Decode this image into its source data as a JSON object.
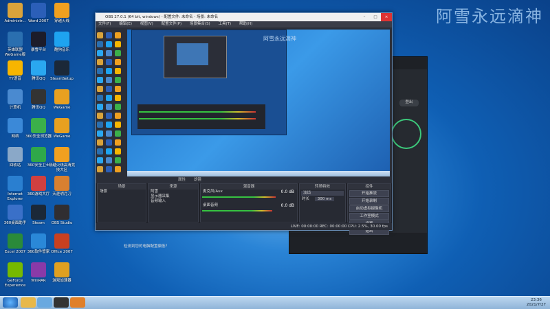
{
  "watermark": "阿雪永远滴神",
  "preview_watermark": "阿雪永远滴神",
  "desktop_icons": [
    {
      "label": "Administr...",
      "color": "#d9a33b"
    },
    {
      "label": "Word 2007",
      "color": "#2b5fb8"
    },
    {
      "label": "穿越火线",
      "color": "#f0a020"
    },
    {
      "label": "英雄联盟 WeGame版",
      "color": "#2a6fb0"
    },
    {
      "label": "暴雪平台",
      "color": "#1c1c2a"
    },
    {
      "label": "酷狗音乐",
      "color": "#1ea3f0"
    },
    {
      "label": "YY语音",
      "color": "#f7b500"
    },
    {
      "label": "腾讯QQ",
      "color": "#2aa7f0"
    },
    {
      "label": "SteamSetup",
      "color": "#1b2838"
    },
    {
      "label": "计算机",
      "color": "#4a8ad0"
    },
    {
      "label": "腾讯QQ",
      "color": "#333"
    },
    {
      "label": "WeGame",
      "color": "#e8a020"
    },
    {
      "label": "网络",
      "color": "#3b89d8"
    },
    {
      "label": "360安全浏览器",
      "color": "#3bb04a"
    },
    {
      "label": "WeGame",
      "color": "#e8a020"
    },
    {
      "label": "回收站",
      "color": "#8aa8c8"
    },
    {
      "label": "360安全卫士",
      "color": "#2fa84a"
    },
    {
      "label": "穿越火线高清竞技大区",
      "color": "#f0a020"
    },
    {
      "label": "Internet Explorer",
      "color": "#2a7fd0"
    },
    {
      "label": "360游戏大厅",
      "color": "#d04040"
    },
    {
      "label": "天涯明月刀",
      "color": "#d88030"
    },
    {
      "label": "360桌面助手",
      "color": "#3a70c8"
    },
    {
      "label": "Steam",
      "color": "#1b2838"
    },
    {
      "label": "OBS Studio",
      "color": "#302e31"
    },
    {
      "label": "Excel 2007",
      "color": "#2a8a3a"
    },
    {
      "label": "360软件管家",
      "color": "#2a88d8"
    },
    {
      "label": "Office 2007",
      "color": "#c84020"
    },
    {
      "label": "GeForce Experience",
      "color": "#76b900"
    },
    {
      "label": "WinRAR",
      "color": "#8a3aa8"
    },
    {
      "label": "游戏加速器",
      "color": "#e0a020"
    }
  ],
  "obs": {
    "title": "OBS 27.0.1 (64 bit, windows) - 配置文件: 未命名 - 场景: 未命名",
    "menu": [
      "文件(F)",
      "编辑(E)",
      "视图(V)",
      "配置文件(P)",
      "场景集合(S)",
      "工具(T)",
      "帮助(H)"
    ],
    "source_toolbar": [
      "属性",
      "滤镜"
    ],
    "scene_dock_title": "场景",
    "scene_item": "场景",
    "source_dock_title": "来源",
    "sources": [
      "阿雪",
      "显示器采集",
      "音频输入"
    ],
    "mixer_title": "混音器",
    "mixer_tracks": [
      {
        "name": "麦克风/Aux",
        "db": "0.0 dB",
        "level": 0.72
      },
      {
        "name": "桌面音频",
        "db": "0.0 dB",
        "level": 0.64
      }
    ],
    "transition_title": "转场特效",
    "transition_select": "淡出",
    "duration_label": "时长",
    "duration_value": "300 ms",
    "controls_title": "控件",
    "controls": [
      "开始推流",
      "开始录制",
      "启动虚拟摄像机",
      "工作室模式",
      "设置",
      "退出"
    ],
    "status": "LIVE: 00:00:00   REC: 00:00:00   CPU: 2.5%, 30.00 fps"
  },
  "dark_window": {
    "login_button": "登出"
  },
  "notice": "检测到您的电脑配置偏低？",
  "taskbar": {
    "time": "23:36",
    "date": "2021/7/27"
  }
}
